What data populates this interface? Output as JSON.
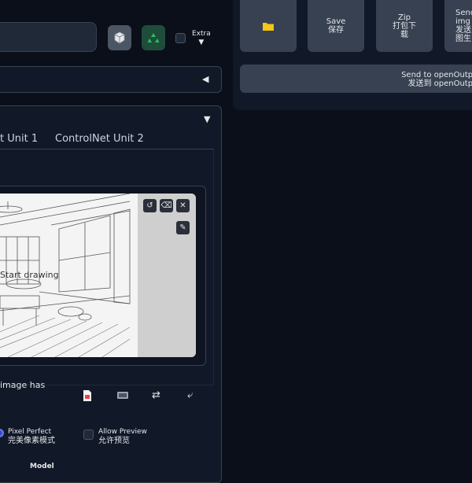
{
  "toolbar": {
    "extra_label": "Extra",
    "extra_arrow": "▼",
    "icons": [
      "refresh-icon-box",
      "recycle-icon"
    ]
  },
  "accordion1": {
    "arrow": "◀"
  },
  "controlnet": {
    "arrow": "▼",
    "tabs": [
      {
        "label": "t Unit 1"
      },
      {
        "label": "ControlNet Unit 2"
      }
    ],
    "canvas_placeholder": "Start drawing",
    "image_note": "image has",
    "pixel_perfect": {
      "en": "Pixel Perfect",
      "zh": "完美像素模式",
      "checked": true
    },
    "allow_preview": {
      "en": "Allow Preview",
      "zh": "允许预览",
      "checked": false
    },
    "model_label": "Model"
  },
  "actions": {
    "folder_icon": "folder-icon",
    "save": {
      "en": "Save",
      "zh": "保存"
    },
    "zip": {
      "en": "Zip",
      "zh": "打包下载"
    },
    "send_img": {
      "en": "Send",
      "zh1": "img",
      "zh2": "发送",
      "zh3": "图生"
    },
    "send_outpaint": {
      "en": "Send to openOutpai",
      "zh": "发送到 openOutpai"
    }
  },
  "colors": {
    "bg": "#0b0f19",
    "panel": "#111827",
    "button": "#374151",
    "folder": "#f5c518",
    "accent_green": "#22c55e"
  }
}
